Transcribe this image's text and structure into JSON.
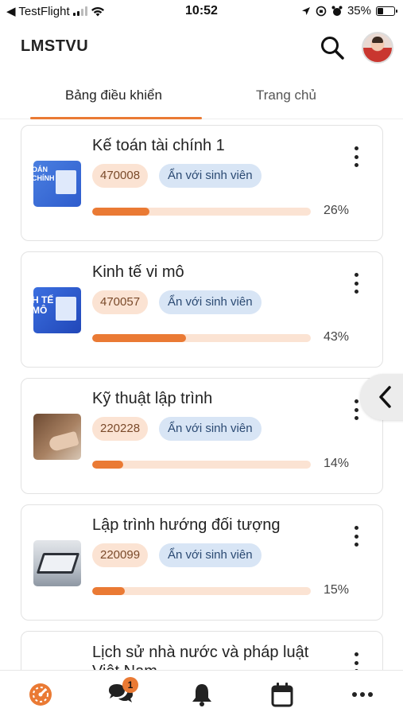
{
  "status_bar": {
    "back_app": "◀ TestFlight",
    "time": "10:52",
    "battery": "35%"
  },
  "header": {
    "title": "LMSTVU"
  },
  "tabs": [
    {
      "label": "Bảng điều khiển",
      "active": true
    },
    {
      "label": "Trang chủ",
      "active": false
    }
  ],
  "courses": [
    {
      "title": "Kế toán tài chính 1",
      "code": "470008",
      "visibility": "Ẩn với sinh viên",
      "progress_pct": 26,
      "progress_label": "26%",
      "thumb_text": "OÁN\nCHÍNH"
    },
    {
      "title": "Kinh tế vi mô",
      "code": "470057",
      "visibility": "Ẩn với sinh viên",
      "progress_pct": 43,
      "progress_label": "43%",
      "thumb_text": "H TẾ\nMÔ"
    },
    {
      "title": "Kỹ thuật lập trình",
      "code": "220228",
      "visibility": "Ẩn với sinh viên",
      "progress_pct": 14,
      "progress_label": "14%"
    },
    {
      "title": "Lập trình hướng đối tượng",
      "code": "220099",
      "visibility": "Ẩn với sinh viên",
      "progress_pct": 15,
      "progress_label": "15%"
    },
    {
      "title": "Lịch sử nhà nước và pháp luật",
      "title_line2": "Việt Nam"
    }
  ],
  "bottom_nav": {
    "messages_badge": "1"
  },
  "colors": {
    "accent": "#ea7a34",
    "code_badge_bg": "#fbe3d3",
    "hidden_badge_bg": "#d8e5f5"
  },
  "icons": {
    "search": "search-icon",
    "dashboard": "dashboard-icon",
    "messages": "chat-icon",
    "notifications": "bell-icon",
    "calendar": "calendar-icon",
    "more": "more-icon",
    "side_handle": "chevron-left-icon"
  }
}
